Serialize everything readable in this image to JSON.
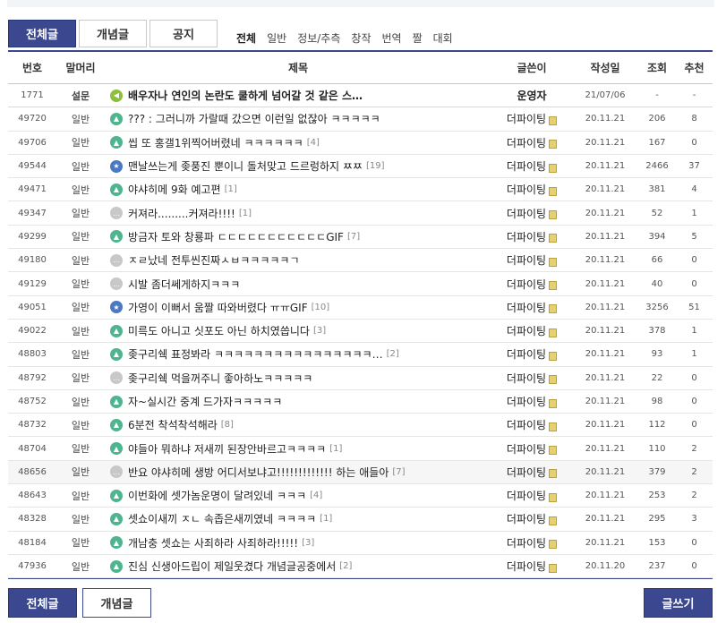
{
  "tabs": [
    {
      "label": "전체글",
      "active": true
    },
    {
      "label": "개념글",
      "active": false
    },
    {
      "label": "공지",
      "active": false
    }
  ],
  "categories": [
    {
      "label": "전체",
      "active": true
    },
    {
      "label": "일반",
      "active": false
    },
    {
      "label": "정보/추측",
      "active": false
    },
    {
      "label": "창작",
      "active": false
    },
    {
      "label": "번역",
      "active": false
    },
    {
      "label": "짤",
      "active": false
    },
    {
      "label": "대회",
      "active": false
    }
  ],
  "columns": {
    "no": "번호",
    "head": "말머리",
    "title": "제목",
    "user": "글쓴이",
    "date": "작성일",
    "views": "조회",
    "recommend": "추천"
  },
  "notice": {
    "no": "1771",
    "head": "설문",
    "title": "배우자나 연인의 논란도 쿨하게 넘어갈 것 같은 스…",
    "user": "운영자",
    "date": "21/07/06",
    "views": "-",
    "recommend": "-",
    "icon": "notice-icon"
  },
  "posts": [
    {
      "no": "49720",
      "head": "일반",
      "icon": "img",
      "title": "??? : 그러니까 가랄때 갔으면 이런일 없잖아 ㅋㅋㅋㅋㅋ",
      "reply": "",
      "user": "더파이팅",
      "date": "20.11.21",
      "views": "206",
      "recommend": "8"
    },
    {
      "no": "49706",
      "head": "일반",
      "icon": "img",
      "title": "씹 또 홍갤1위찍어버렸네 ㅋㅋㅋㅋㅋㅋ",
      "reply": "[4]",
      "user": "더파이팅",
      "date": "20.11.21",
      "views": "167",
      "recommend": "0"
    },
    {
      "no": "49544",
      "head": "일반",
      "icon": "star",
      "title": "맨날쓰는게 좆풍진 뿐이니 돌처맞고 드르렁하지 ㅉㅉ",
      "reply": "[19]",
      "user": "더파이팅",
      "date": "20.11.21",
      "views": "2466",
      "recommend": "37"
    },
    {
      "no": "49471",
      "head": "일반",
      "icon": "img",
      "title": "야샤히메 9화 예고편",
      "reply": "[1]",
      "user": "더파이팅",
      "date": "20.11.21",
      "views": "381",
      "recommend": "4"
    },
    {
      "no": "49347",
      "head": "일반",
      "icon": "chat",
      "title": "커져라.........커져라!!!!",
      "reply": "[1]",
      "user": "더파이팅",
      "date": "20.11.21",
      "views": "52",
      "recommend": "1"
    },
    {
      "no": "49299",
      "head": "일반",
      "icon": "img",
      "title": "방금자 토와 창룡파 ㄷㄷㄷㄷㄷㄷㄷㄷㄷㄷㄷGIF",
      "reply": "[7]",
      "user": "더파이팅",
      "date": "20.11.21",
      "views": "394",
      "recommend": "5"
    },
    {
      "no": "49180",
      "head": "일반",
      "icon": "chat",
      "title": "ㅈㄹ났네 전투씬진짜ㅅㅂㅋㅋㅋㅋㅋㄱ",
      "reply": "",
      "user": "더파이팅",
      "date": "20.11.21",
      "views": "66",
      "recommend": "0"
    },
    {
      "no": "49129",
      "head": "일반",
      "icon": "chat",
      "title": "시발 좀더쎄게하지ㅋㅋㅋ",
      "reply": "",
      "user": "더파이팅",
      "date": "20.11.21",
      "views": "40",
      "recommend": "0"
    },
    {
      "no": "49051",
      "head": "일반",
      "icon": "star",
      "title": "가영이 이뻐서 움짤 따와버렸다 ㅠㅠGIF",
      "reply": "[10]",
      "user": "더파이팅",
      "date": "20.11.21",
      "views": "3256",
      "recommend": "51"
    },
    {
      "no": "49022",
      "head": "일반",
      "icon": "img",
      "title": "미륵도 아니고 싯포도 아닌 하치였씁니다",
      "reply": "[3]",
      "user": "더파이팅",
      "date": "20.11.21",
      "views": "378",
      "recommend": "1"
    },
    {
      "no": "48803",
      "head": "일반",
      "icon": "img",
      "title": "좆구리쉑 표정봐라 ㅋㅋㅋㅋㅋㅋㅋㅋㅋㅋㅋㅋㅋㅋㅋㅋ…",
      "reply": "[2]",
      "user": "더파이팅",
      "date": "20.11.21",
      "views": "93",
      "recommend": "1"
    },
    {
      "no": "48792",
      "head": "일반",
      "icon": "chat",
      "title": "좆구리쉑 먹을꺼주니 좋아하노ㅋㅋㅋㅋㅋ",
      "reply": "",
      "user": "더파이팅",
      "date": "20.11.21",
      "views": "22",
      "recommend": "0"
    },
    {
      "no": "48752",
      "head": "일반",
      "icon": "img",
      "title": "자~실시간 중계 드가자ㅋㅋㅋㅋㅋ",
      "reply": "",
      "user": "더파이팅",
      "date": "20.11.21",
      "views": "98",
      "recommend": "0"
    },
    {
      "no": "48732",
      "head": "일반",
      "icon": "img",
      "title": "6분전 착석착석해라",
      "reply": "[8]",
      "user": "더파이팅",
      "date": "20.11.21",
      "views": "112",
      "recommend": "0"
    },
    {
      "no": "48704",
      "head": "일반",
      "icon": "img",
      "title": "야들아 뭐하냐 저새끼 된장안바르고ㅋㅋㅋㅋ",
      "reply": "[1]",
      "user": "더파이팅",
      "date": "20.11.21",
      "views": "110",
      "recommend": "2"
    },
    {
      "no": "48656",
      "head": "일반",
      "icon": "chat",
      "title": "반요 야샤히메 생방 어디서보냐고!!!!!!!!!!!!! 하는 애들아",
      "reply": "[7]",
      "user": "더파이팅",
      "date": "20.11.21",
      "views": "379",
      "recommend": "2",
      "highlight": true
    },
    {
      "no": "48643",
      "head": "일반",
      "icon": "img",
      "title": "이번화에 셋가놈운명이 달려있네 ㅋㅋㅋ",
      "reply": "[4]",
      "user": "더파이팅",
      "date": "20.11.21",
      "views": "253",
      "recommend": "2"
    },
    {
      "no": "48328",
      "head": "일반",
      "icon": "img",
      "title": "셋쇼이새끼 ㅈㄴ 속좁은새끼였네 ㅋㅋㅋㅋ",
      "reply": "[1]",
      "user": "더파이팅",
      "date": "20.11.21",
      "views": "295",
      "recommend": "3"
    },
    {
      "no": "48184",
      "head": "일반",
      "icon": "img",
      "title": "개남충 셋쇼는 사죄하라 사죄하라!!!!!",
      "reply": "[3]",
      "user": "더파이팅",
      "date": "20.11.21",
      "views": "153",
      "recommend": "0"
    },
    {
      "no": "47936",
      "head": "일반",
      "icon": "img",
      "title": "진심 신생아드립이 제일웃겼다 개념글공중에서",
      "reply": "[2]",
      "user": "더파이팅",
      "date": "20.11.20",
      "views": "237",
      "recommend": "0"
    }
  ],
  "bottom": {
    "all_label": "전체글",
    "concept_label": "개념글",
    "write_label": "글쓰기"
  },
  "colors": {
    "accent": "#3b4890",
    "img_icon": "#4fb58e",
    "chat_icon": "#c8c8c8",
    "star_icon": "#4a78c2",
    "notice_icon": "#8dbf3c"
  }
}
